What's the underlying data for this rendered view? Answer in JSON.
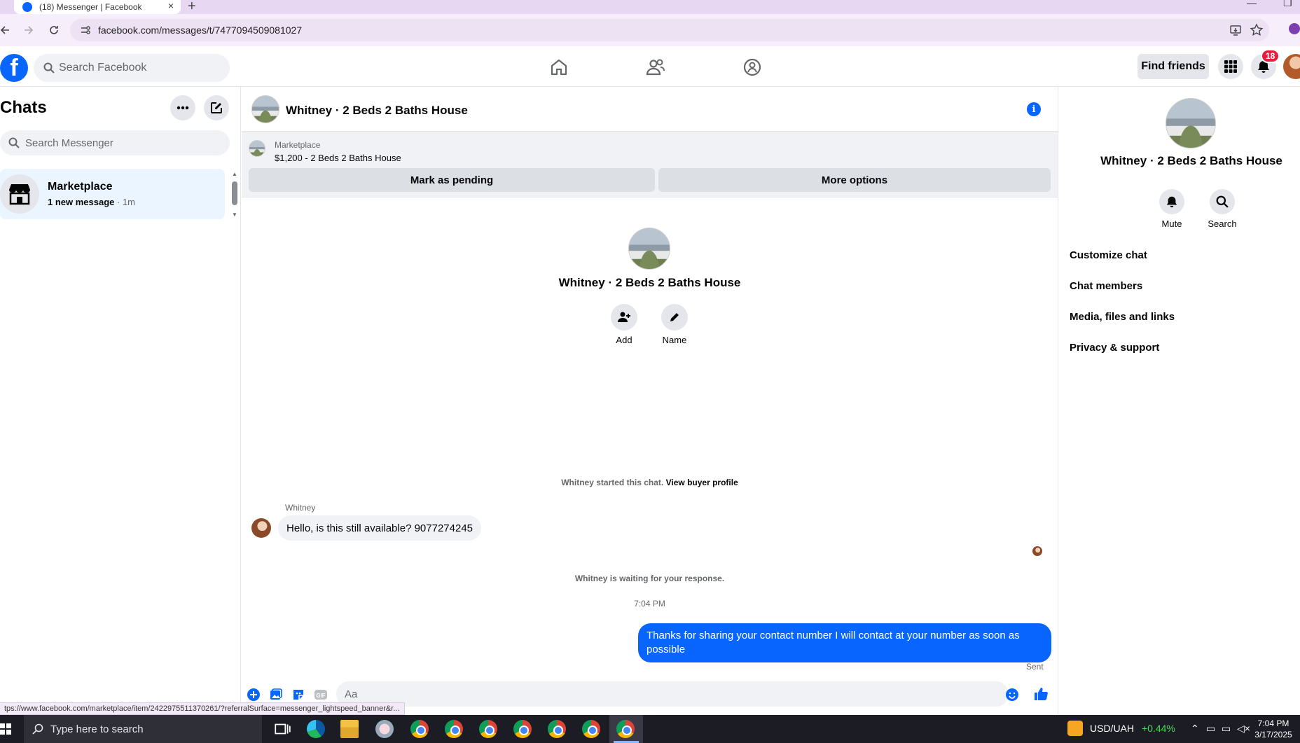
{
  "browser": {
    "tab_title": "(18) Messenger | Facebook",
    "tab_close": "×",
    "new_tab": "+",
    "url": "facebook.com/messages/t/7477094509081027",
    "status_url": "tps://www.facebook.com/marketplace/item/2422975511370261/?referralSurface=messenger_lightspeed_banner&r..."
  },
  "fb_header": {
    "search_placeholder": "Search Facebook",
    "find_friends": "Find friends",
    "notification_count": "18",
    "logo_letter": "f"
  },
  "chats": {
    "title": "Chats",
    "search_placeholder": "Search Messenger",
    "items": [
      {
        "name": "Marketplace",
        "preview": "1 new message",
        "sep": " · ",
        "time": "1m"
      }
    ]
  },
  "conversation": {
    "title": "Whitney · 2 Beds 2 Baths House",
    "info_glyph": "i",
    "marketplace": {
      "label": "Marketplace",
      "listing": "$1,200 - 2 Beds 2 Baths House",
      "mark_pending": "Mark as pending",
      "more_options": "More options"
    },
    "intro": {
      "name": "Whitney · 2 Beds 2 Baths House",
      "add_label": "Add",
      "name_label": "Name"
    },
    "started_text": "Whitney started this chat.",
    "view_buyer_profile": "View buyer profile",
    "sender": "Whitney",
    "incoming_message": "Hello, is this still available? 9077274245",
    "waiting_text": "Whitney is waiting for your response.",
    "timestamp": "7:04 PM",
    "outgoing_message": "Thanks for sharing your contact number I will contact at your number as soon as possible",
    "sent_label": "Sent",
    "composer_placeholder": "Aa"
  },
  "details": {
    "name": "Whitney · 2 Beds 2 Baths House",
    "mute_label": "Mute",
    "search_label": "Search",
    "links": [
      "Customize chat",
      "Chat members",
      "Media, files and links",
      "Privacy & support"
    ]
  },
  "taskbar": {
    "search_placeholder": "Type here to search",
    "currency": "USD/UAH",
    "currency_change": "+0.44%",
    "time": "7:04 PM",
    "date": "3/17/2025"
  },
  "colors": {
    "fb_blue": "#0866ff",
    "badge_red": "#e41e3f",
    "selected_chat_bg": "#ebf5ff",
    "currency_green": "#4cd964"
  }
}
